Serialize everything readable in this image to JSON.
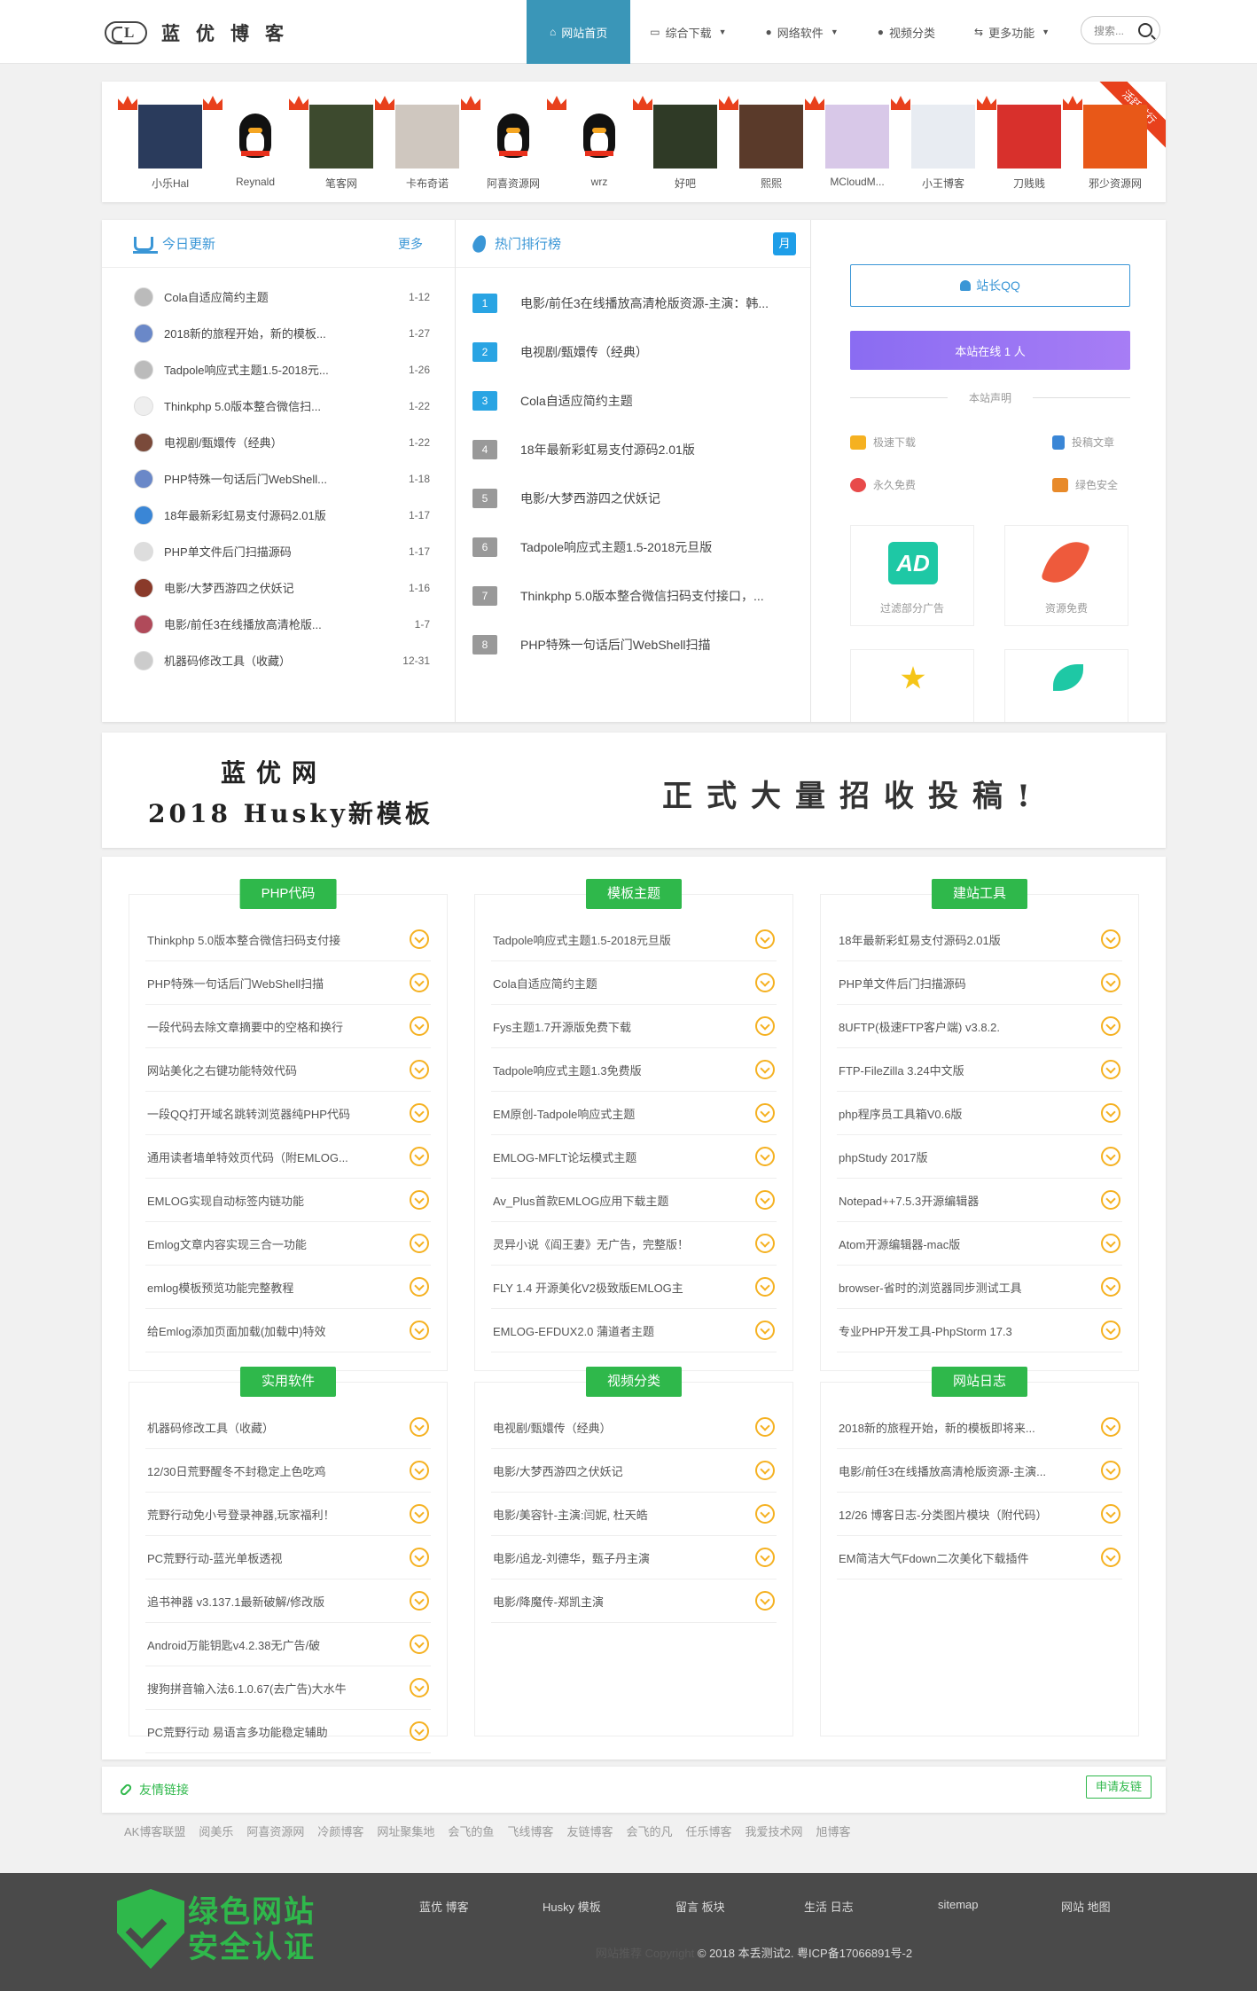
{
  "header": {
    "logo_text": "蓝优博客",
    "nav": [
      {
        "label": "网站首页",
        "icon": "home-icon",
        "active": true
      },
      {
        "label": "综合下载",
        "icon": "monitor-icon",
        "dropdown": true
      },
      {
        "label": "网络软件",
        "icon": "circle-play-icon",
        "dropdown": true
      },
      {
        "label": "视频分类",
        "icon": "circle-play-icon",
        "dropdown": false
      },
      {
        "label": "更多功能",
        "icon": "share-icon",
        "dropdown": true
      }
    ],
    "search_placeholder": "搜索..."
  },
  "visitors": {
    "ribbon": "活跃排行",
    "items": [
      {
        "name": "小乐Hal",
        "color": "#2a3b5c"
      },
      {
        "name": "Reynald",
        "color": "#ffffff"
      },
      {
        "name": "笔客网",
        "color": "#3d4a2e"
      },
      {
        "name": "卡布奇诺",
        "color": "#cfc7bf"
      },
      {
        "name": "阿喜资源网",
        "color": "#ffffff"
      },
      {
        "name": "wrz",
        "color": "#ffffff"
      },
      {
        "name": "好吧",
        "color": "#2f3a26"
      },
      {
        "name": "熙熙",
        "color": "#5a3a2a"
      },
      {
        "name": "MCloudM...",
        "color": "#d8c8e8"
      },
      {
        "name": "小王博客",
        "color": "#e8ecf2"
      },
      {
        "name": "刀贱贱",
        "color": "#d8302c"
      },
      {
        "name": "邪少资源网",
        "color": "#e85818"
      }
    ]
  },
  "today": {
    "title": "今日更新",
    "more": "更多",
    "items": [
      {
        "title": "Cola自适应简约主题",
        "date": "1-12",
        "color": "#bbb"
      },
      {
        "title": "2018新的旅程开始，新的模板...",
        "date": "1-27",
        "color": "#6a88c8"
      },
      {
        "title": "Tadpole响应式主题1.5-2018元...",
        "date": "1-26",
        "color": "#bbb"
      },
      {
        "title": "Thinkphp 5.0版本整合微信扫...",
        "date": "1-22",
        "color": "#eee"
      },
      {
        "title": "电视剧/甄嬛传（经典）",
        "date": "1-22",
        "color": "#7a4a3a"
      },
      {
        "title": "PHP特殊一句话后门WebShell...",
        "date": "1-18",
        "color": "#6a88c8"
      },
      {
        "title": "18年最新彩虹易支付源码2.01版",
        "date": "1-17",
        "color": "#3a86d6"
      },
      {
        "title": "PHP单文件后门扫描源码",
        "date": "1-17",
        "color": "#ddd"
      },
      {
        "title": "电影/大梦西游四之伏妖记",
        "date": "1-16",
        "color": "#8a3a2a"
      },
      {
        "title": "电影/前任3在线播放高清枪版...",
        "date": "1-7",
        "color": "#b04a5a"
      },
      {
        "title": "机器码修改工具（收藏）",
        "date": "12-31",
        "color": "#ccc"
      }
    ]
  },
  "hot": {
    "title": "热门排行榜",
    "badge": "月",
    "items": [
      {
        "rank": "1",
        "title": "电影/前任3在线播放高清枪版资源-主演：韩..."
      },
      {
        "rank": "2",
        "title": "电视剧/甄嬛传（经典）"
      },
      {
        "rank": "3",
        "title": "Cola自适应简约主题"
      },
      {
        "rank": "4",
        "title": "18年最新彩虹易支付源码2.01版"
      },
      {
        "rank": "5",
        "title": "电影/大梦西游四之伏妖记"
      },
      {
        "rank": "6",
        "title": "Tadpole响应式主题1.5-2018元旦版"
      },
      {
        "rank": "7",
        "title": "Thinkphp 5.0版本整合微信扫码支付接口，..."
      },
      {
        "rank": "8",
        "title": "PHP特殊一句话后门WebShell扫描"
      }
    ]
  },
  "sidebar": {
    "qq": "站长QQ",
    "online": "本站在线 1 人",
    "declaration": "本站声明",
    "features": [
      "极速下载",
      "投稿文章",
      "永久免费",
      "绿色安全"
    ],
    "tiles": [
      "过滤部分广告",
      "资源免费"
    ]
  },
  "banner": {
    "line1": "蓝优网",
    "line2": "2018 Husky新模板",
    "right": "正式大量招收投稿!"
  },
  "categories": [
    {
      "tag": "PHP代码",
      "items": [
        "Thinkphp 5.0版本整合微信扫码支付接",
        "PHP特殊一句话后门WebShell扫描",
        "一段代码去除文章摘要中的空格和换行",
        "网站美化之右键功能特效代码",
        "一段QQ打开域名跳转浏览器纯PHP代码",
        "通用读者墙单特效页代码（附EMLOG...",
        "EMLOG实现自动标签内链功能",
        "Emlog文章内容实现三合一功能",
        "emlog模板预览功能完整教程",
        "给Emlog添加页面加载(加载中)特效"
      ]
    },
    {
      "tag": "模板主题",
      "items": [
        "Tadpole响应式主题1.5-2018元旦版",
        "Cola自适应简约主题",
        "Fys主题1.7开源版免费下载",
        "Tadpole响应式主题1.3免费版",
        "EM原创-Tadpole响应式主题",
        "EMLOG-MFLT论坛模式主题",
        "Av_Plus首款EMLOG应用下载主题",
        "灵异小说《阎王妻》无广告，完整版！",
        "FLY 1.4 开源美化V2极致版EMLOG主",
        "EMLOG-EFDUX2.0 蒲道者主题"
      ]
    },
    {
      "tag": "建站工具",
      "items": [
        "18年最新彩虹易支付源码2.01版",
        "PHP单文件后门扫描源码",
        "8UFTP(极速FTP客户端) v3.8.2.",
        "FTP-FileZilla 3.24中文版",
        "php程序员工具箱V0.6版",
        "phpStudy 2017版",
        "Notepad++7.5.3开源编辑器",
        "Atom开源编辑器-mac版",
        "browser-省时的浏览器同步测试工具",
        "专业PHP开发工具-PhpStorm 17.3"
      ]
    },
    {
      "tag": "实用软件",
      "items": [
        "机器码修改工具（收藏）",
        "12/30日荒野醒冬不封稳定上色吃鸡",
        "荒野行动免小号登录神器,玩家福利！",
        "PC荒野行动-蓝光单板透视",
        "追书神器 v3.137.1最新破解/修改版",
        "Android万能钥匙v4.2.38无广告/破",
        "搜狗拼音输入法6.1.0.67(去广告)大水牛",
        "PC荒野行动 易语言多功能稳定辅助"
      ]
    },
    {
      "tag": "视频分类",
      "items": [
        "电视剧/甄嬛传（经典）",
        "电影/大梦西游四之伏妖记",
        "电影/美容针-主演:闫妮, 杜天皓",
        "电影/追龙-刘德华，甄子丹主演",
        "电影/降魔传-郑凯主演"
      ]
    },
    {
      "tag": "网站日志",
      "items": [
        "2018新的旅程开始，新的模板即将来...",
        "电影/前任3在线播放高清枪版资源-主演...",
        "12/26 博客日志-分类图片模块（附代码）",
        "EM简洁大气Fdown二次美化下载插件"
      ]
    }
  ],
  "friends": {
    "title": "友情链接",
    "apply": "申请友链",
    "links": [
      "AK博客联盟",
      "阅美乐",
      "阿喜资源网",
      "冷颜博客",
      "网址聚集地",
      "会飞的鱼",
      "飞线博客",
      "友链博客",
      "会飞的凡",
      "任乐博客",
      "我爱技术网",
      "旭博客"
    ]
  },
  "footer": {
    "cert": [
      "绿色网站",
      "安全认证"
    ],
    "nav": [
      "蓝优 博客",
      "Husky 模板",
      "留言 板块",
      "生活 日志",
      "sitemap",
      "网站 地图"
    ],
    "copyright_dim": "网站推荐 Copyright",
    "copyright": "© 2018 本丢测试2. 粤ICP备17066891号-2"
  }
}
